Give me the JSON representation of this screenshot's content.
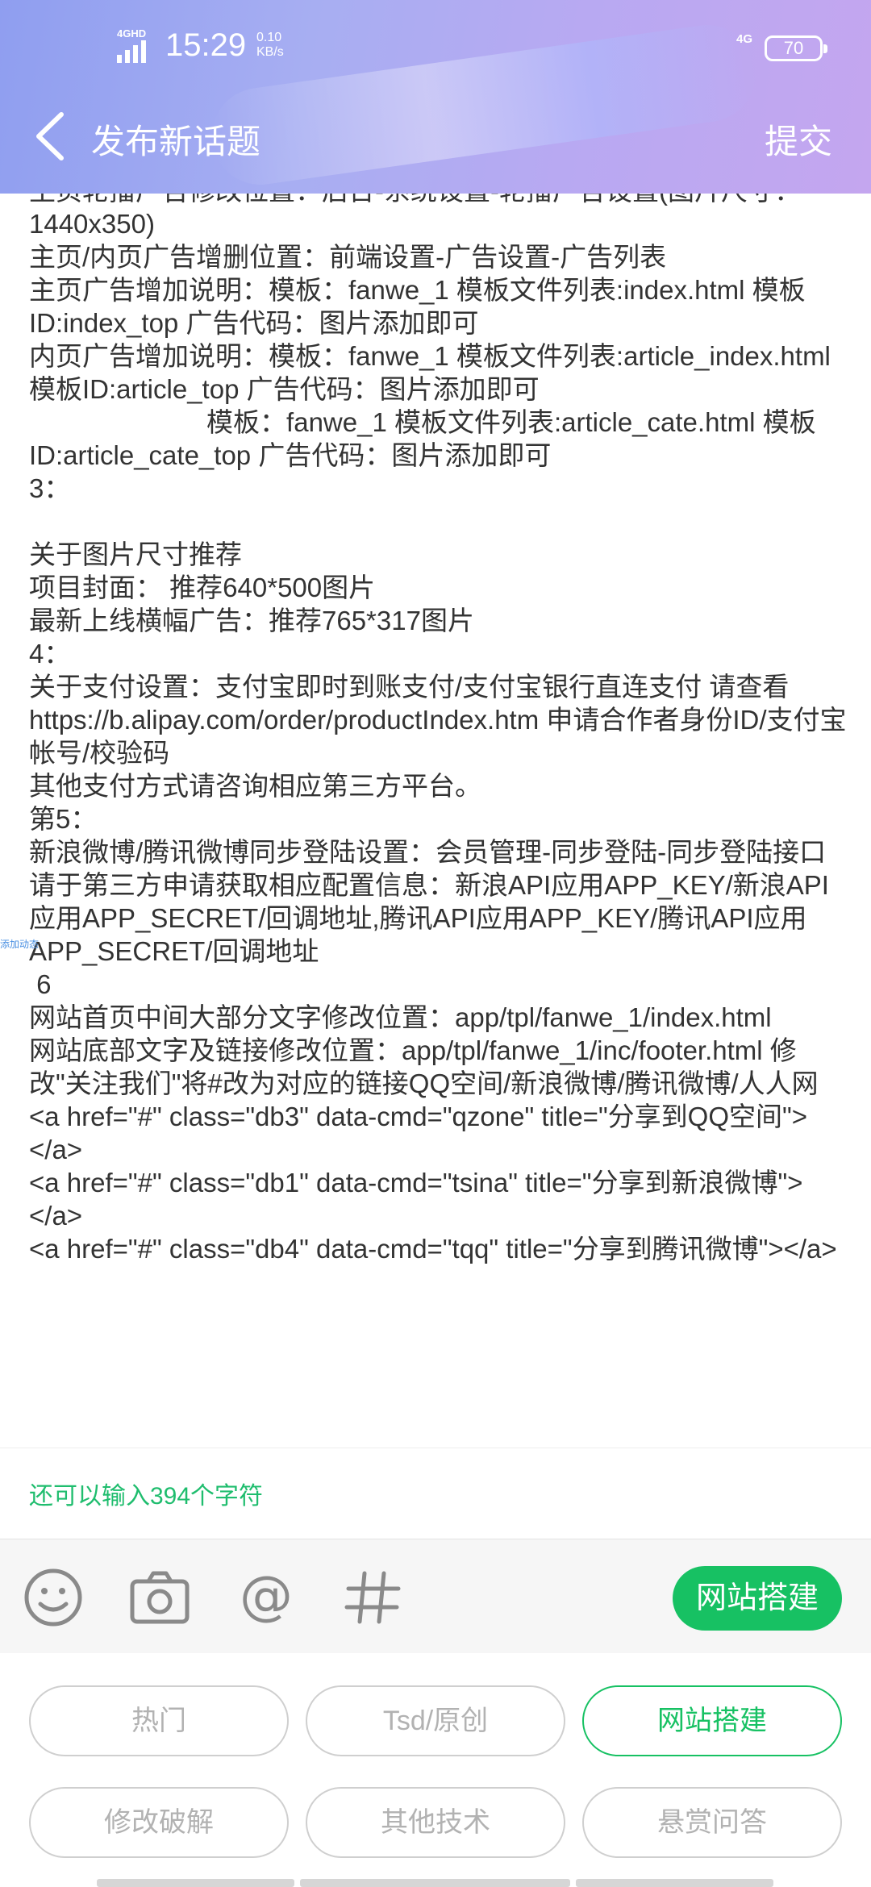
{
  "status_bar": {
    "network_left": "4GHD",
    "time": "15:29",
    "speed_value": "0.10",
    "speed_unit": "KB/s",
    "network_right": "4G",
    "battery": "70"
  },
  "nav": {
    "title": "发布新话题",
    "submit_label": "提交",
    "back_icon": "chevron-left-icon"
  },
  "editor": {
    "content": "主页轮播广告修改位置：后台-系统设置-轮播广告设置(图片尺寸：1440x350)\n主页/内页广告增删位置：前端设置-广告设置-广告列表\n主页广告增加说明：模板：fanwe_1 模板文件列表:index.html 模板ID:index_top 广告代码：图片添加即可\n内页广告增加说明：模板：fanwe_1 模板文件列表:article_index.html 模板ID:article_top 广告代码：图片添加即可\n                        模板：fanwe_1 模板文件列表:article_cate.html 模板ID:article_cate_top 广告代码：图片添加即可\n3：\n\n关于图片尺寸推荐\n项目封面： 推荐640*500图片\n最新上线横幅广告：推荐765*317图片\n4：\n关于支付设置：支付宝即时到账支付/支付宝银行直连支付 请查看https://b.alipay.com/order/productIndex.htm 申请合作者身份ID/支付宝帐号/校验码\n其他支付方式请咨询相应第三方平台。\n第5：\n新浪微博/腾讯微博同步登陆设置：会员管理-同步登陆-同步登陆接口\n请于第三方申请获取相应配置信息：新浪API应用APP_KEY/新浪API应用APP_SECRET/回调地址,腾讯API应用APP_KEY/腾讯API应用APP_SECRET/回调地址\n 6\n网站首页中间大部分文字修改位置：app/tpl/fanwe_1/index.html\n网站底部文字及链接修改位置：app/tpl/fanwe_1/inc/footer.html 修改\"关注我们\"将#改为对应的链接QQ空间/新浪微博/腾讯微博/人人网\n<a href=\"#\" class=\"db3\" data-cmd=\"qzone\" title=\"分享到QQ空间\"></a>\n<a href=\"#\" class=\"db1\" data-cmd=\"tsina\" title=\"分享到新浪微博\"></a>\n<a href=\"#\" class=\"db4\" data-cmd=\"tqq\" title=\"分享到腾讯微博\"></a>",
    "side_tag": "添加动态"
  },
  "counter_text": "还可以输入394个字符",
  "toolbar": {
    "icons": [
      "emoji-icon",
      "camera-icon",
      "at-icon",
      "hashtag-icon"
    ],
    "selected_topic": "网站搭建"
  },
  "tags": [
    {
      "label": "热门",
      "active": false
    },
    {
      "label": "Tsd/原创",
      "active": false
    },
    {
      "label": "网站搭建",
      "active": true
    },
    {
      "label": "修改破解",
      "active": false
    },
    {
      "label": "其他技术",
      "active": false
    },
    {
      "label": "悬赏问答",
      "active": false
    }
  ],
  "colors": {
    "accent": "#17c163",
    "counter": "#1fbd6e",
    "tag_border": "#cfcfcf",
    "tag_text": "#b2b2b2"
  }
}
